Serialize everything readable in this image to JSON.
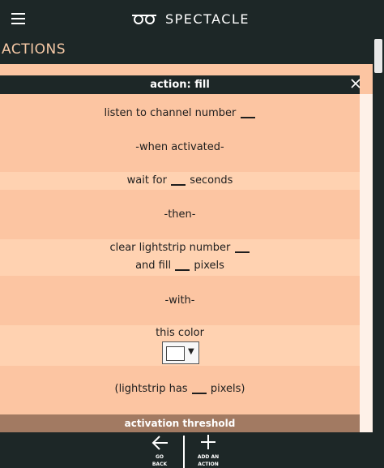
{
  "header": {
    "app_name": "SPECTACLE",
    "menu_icon": "hamburger-icon",
    "logo_icon": "glasses-icon"
  },
  "section": {
    "title": "ACTIONS"
  },
  "action": {
    "title": "action: fill",
    "close_icon": "close-icon",
    "channel": {
      "before": "listen to channel number"
    },
    "when_activated": "-when activated-",
    "wait": {
      "before": "wait for",
      "after": "seconds"
    },
    "then": "-then-",
    "clear": {
      "before": "clear lightstrip number"
    },
    "fill": {
      "before": "and fill",
      "after": "pixels"
    },
    "with": "-with-",
    "color": {
      "label": "this color",
      "value_color": "#ffffff"
    },
    "lightstrip": {
      "before": "(lightstrip has",
      "after": "pixels)"
    },
    "threshold": "activation threshold"
  },
  "bottom": {
    "back": {
      "line1": "GO",
      "line2": "BACK",
      "icon": "arrow-left-icon"
    },
    "add": {
      "line1": "ADD AN",
      "line2": "ACTION",
      "icon": "plus-icon"
    }
  },
  "colors": {
    "dark": "#1d2727",
    "accent_text": "#f6c9a6",
    "band_peach": "#fcc5a2",
    "band_light": "#ffd2b1",
    "threshold_bg": "#a27a62"
  }
}
